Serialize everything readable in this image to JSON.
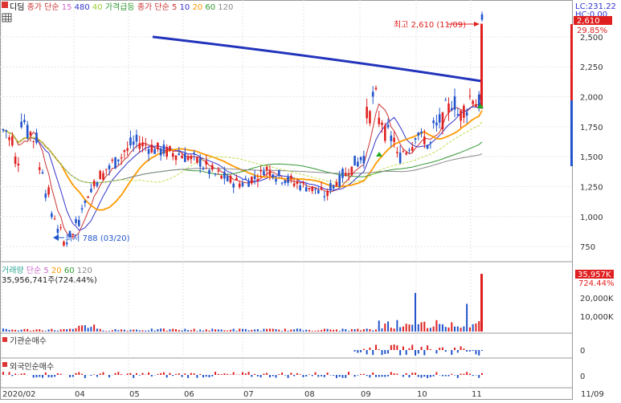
{
  "header": {
    "items": [
      {
        "text": "디딤",
        "color": "#000000"
      },
      {
        "text": "종가 단순",
        "color": "#cc3333"
      },
      {
        "text": "15",
        "color": "#cc66cc"
      },
      {
        "text": "480",
        "color": "#3333cc"
      },
      {
        "text": "40",
        "color": "#99cc33"
      },
      {
        "text": "가격급등",
        "color": "#339933"
      },
      {
        "text": "종가 단순",
        "color": "#cc3333"
      },
      {
        "text": "5",
        "color": "#cc3333"
      },
      {
        "text": "10",
        "color": "#3333cc"
      },
      {
        "text": "20",
        "color": "#ff9900"
      },
      {
        "text": "60",
        "color": "#339933"
      },
      {
        "text": "120",
        "color": "#888888"
      }
    ],
    "lc": "LC:231.22",
    "hc": "HC:0.00"
  },
  "price": {
    "current": "2,610",
    "change": "29.85%",
    "high_annotation": "최고 2,610 (11/09)",
    "low_annotation": "최저 788 (03/20)",
    "y_ticks": [
      "2,500",
      "2,250",
      "2,000",
      "1,750",
      "1,500",
      "1,250",
      "1,000",
      "750"
    ]
  },
  "volume_panel": {
    "legend": [
      {
        "text": "거래량",
        "color": "#33aa99"
      },
      {
        "text": "단순",
        "color": "#cc66cc"
      },
      {
        "text": "5",
        "color": "#cc66cc"
      },
      {
        "text": "20",
        "color": "#ff9900"
      },
      {
        "text": "60",
        "color": "#339933"
      },
      {
        "text": "120",
        "color": "#888888"
      }
    ],
    "value": "35,956,741주(724.44%)",
    "badge_value": "35,957K",
    "badge_pct": "724.44%",
    "ticks": [
      "20,000K",
      "10,000K"
    ]
  },
  "inst_panel": {
    "title": "기관순매수",
    "tick": "0"
  },
  "foreign_panel": {
    "title": "외국인순매수",
    "tick": "0"
  },
  "x_axis": {
    "labels": [
      "2020/02",
      "04",
      "05",
      "06",
      "07",
      "08",
      "09",
      "10",
      "11"
    ],
    "right_label": "11/09"
  },
  "chart_data": {
    "type": "candlestick",
    "title": "디딤",
    "y_range": [
      650,
      2620
    ],
    "volume_range": [
      0,
      36000
    ],
    "months": [
      {
        "label": "2020/02",
        "close": 1650
      },
      {
        "label": "03",
        "close": 850
      },
      {
        "label": "04",
        "close": 1300
      },
      {
        "label": "05",
        "close": 1550
      },
      {
        "label": "06",
        "close": 1400
      },
      {
        "label": "07",
        "close": 1350
      },
      {
        "label": "08",
        "close": 1200
      },
      {
        "label": "09",
        "close": 1700
      },
      {
        "label": "10",
        "close": 1650
      },
      {
        "label": "11",
        "close": 2610
      }
    ],
    "price_path": [
      1720,
      1650,
      1480,
      1800,
      1700,
      1650,
      1400,
      1200,
      1000,
      880,
      788,
      850,
      950,
      1100,
      1200,
      1300,
      1350,
      1400,
      1450,
      1500,
      1550,
      1600,
      1620,
      1600,
      1580,
      1560,
      1550,
      1540,
      1530,
      1520,
      1500,
      1480,
      1460,
      1420,
      1380,
      1350,
      1330,
      1300,
      1290,
      1280,
      1300,
      1320,
      1350,
      1400,
      1380,
      1340,
      1320,
      1300,
      1280,
      1260,
      1250,
      1230,
      1200,
      1180,
      1250,
      1300,
      1350,
      1400,
      1450,
      1500,
      1850,
      2000,
      1800,
      1700,
      1650,
      1500,
      1550,
      1600,
      1700,
      1650,
      1600,
      1750,
      1800,
      1900,
      1950,
      1850,
      1900,
      2000,
      1950,
      2610
    ],
    "ma_480": {
      "start": 2500,
      "end": 2130
    },
    "high": {
      "value": 2610,
      "date": "11/09"
    },
    "low": {
      "value": 788,
      "date": "03/20"
    },
    "last_volume": 35957
  }
}
